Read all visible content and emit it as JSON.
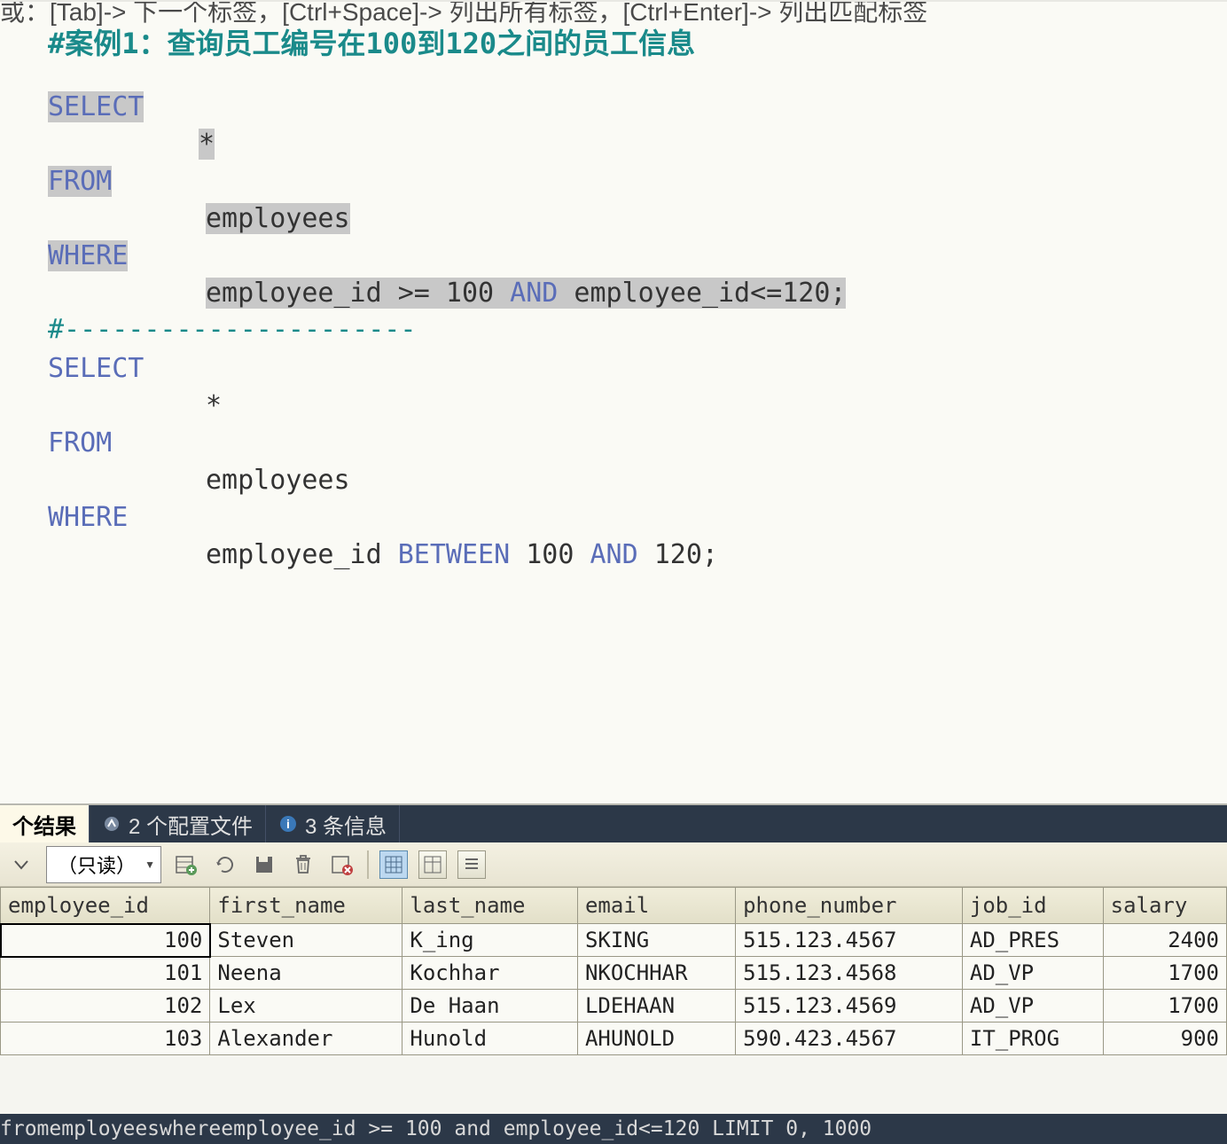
{
  "hints": "或：[Tab]-> 下一个标签，[Ctrl+Space]-> 列出所有标签，[Ctrl+Enter]-> 列出匹配标签",
  "comment1": "#案例1：查询员工编号在100到120之间的员工信息",
  "sql1": {
    "select": "SELECT",
    "star": "*",
    "from": "FROM",
    "table": "employees",
    "where": "WHERE",
    "cond_a": "employee_id >= 100 ",
    "and": "AND",
    "cond_b": " employee_id<=120;"
  },
  "divider": "#----------------------",
  "sql2": {
    "select": "SELECT",
    "star": "*",
    "from": "FROM",
    "table": "employees",
    "where": "WHERE",
    "cond_pre": "employee_id ",
    "between": "BETWEEN",
    "mid": " 100 ",
    "and": "AND",
    "end": " 120;"
  },
  "tabs": {
    "t1": "个结果",
    "t2": "2 个配置文件",
    "t3": "3 条信息"
  },
  "toolbar": {
    "readonly": "（只读）"
  },
  "table": {
    "headers": [
      "employee_id",
      "first_name",
      "last_name",
      "email",
      "phone_number",
      "job_id",
      "salary"
    ],
    "rows": [
      [
        "100",
        "Steven",
        "K_ing",
        "SKING",
        "515.123.4567",
        "AD_PRES",
        "2400"
      ],
      [
        "101",
        "Neena",
        "Kochhar",
        "NKOCHHAR",
        "515.123.4568",
        "AD_VP",
        "1700"
      ],
      [
        "102",
        "Lex",
        "De Haan",
        "LDEHAAN",
        "515.123.4569",
        "AD_VP",
        "1700"
      ],
      [
        "103",
        "Alexander",
        "Hunold",
        "AHUNOLD",
        "590.423.4567",
        "IT_PROG",
        "900"
      ]
    ]
  },
  "status": "fromemployeeswhereemployee_id >= 100 and employee_id<=120 LIMIT 0, 1000"
}
